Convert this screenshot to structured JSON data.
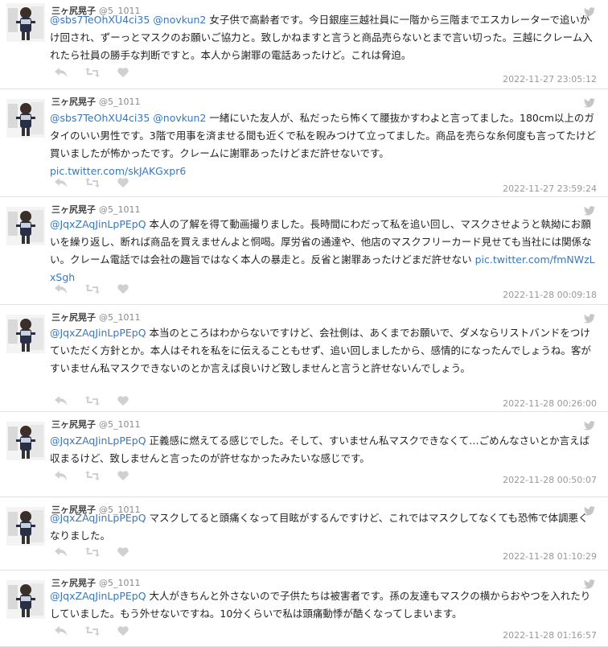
{
  "tweets": [
    {
      "name": "三ヶ尻晃子",
      "handle": "@5_1011",
      "mentions": "@sbs7TeOhXU4ci35 @novkun2",
      "text": " 女子供で高齢者です。今日銀座三越社員に一階から三階までエスカレーターで追いかけ回され、ずーっとマスクのお願いご協力と。致しかねますと言うと商品売らないとまで言い切った。三越にクレーム入れたら社員の勝手な判断ですと。本人から謝罪の電話あったけど。これは脅迫。",
      "link": "",
      "timestamp": "2022-11-27 23:05:12"
    },
    {
      "name": "三ヶ尻晃子",
      "handle": "@5_1011",
      "mentions": "@sbs7TeOhXU4ci35 @novkun2",
      "text": " 一緒にいた友人が、私だったら怖くて腰抜かすわよと言ってました。180cm以上のガタイのいい男性です。3階で用事を済ませる間も近くで私を睨みつけて立ってました。商品を売らな糸何度も言ってたけど買いましたが怖かったです。クレームに謝罪あったけどまだ許せないです。",
      "link": "pic.twitter.com/skJAKGxpr6",
      "timestamp": "2022-11-27 23:59:24"
    },
    {
      "name": "三ヶ尻晃子",
      "handle": "@5_1011",
      "mentions": "@JqxZAqJinLpPEpQ",
      "text": " 本人の了解を得て動画撮りました。長時間にわだって私を追い回し、マスクさせようと執拗にお願いを繰り返し、断れば商品を買えませんよと恫喝。厚労省の通達や、他店のマスクフリーカード見せても当社には関係ない。クレーム電話では会社の趣旨ではなく本人の暴走と。反省と謝罪あったけどまだ許せない ",
      "link": "pic.twitter.com/fmNWzLxSgh",
      "timestamp": "2022-11-28 00:09:18"
    },
    {
      "name": "三ヶ尻晃子",
      "handle": "@5_1011",
      "mentions": "@JqxZAqJinLpPEpQ",
      "text": " 本当のところはわからないですけど、会社側は、あくまでお願いで、ダメならリストバンドをつけていただく方針とか。本人はそれを私をに伝えることもせず、追い回しましたから、感情的になったんでしょうね。客がすいません私マスクできないのとか言えば良いけど致しませんと言うと許せないんでしょう。",
      "link": "",
      "timestamp": "2022-11-28 00:26:00"
    },
    {
      "name": "三ヶ尻晃子",
      "handle": "@5_1011",
      "mentions": "@JqxZAqJinLpPEpQ",
      "text": " 正義感に燃えてる感じでした。そして、すいません私マスクできなくて…ごめんなさいとか言えば収まるけど、致しませんと言ったのが許せなかったみたいな感じです。",
      "link": "",
      "timestamp": "2022-11-28 00:50:07"
    },
    {
      "name": "三ヶ尻晃子",
      "handle": "@5_1011",
      "mentions": "@JqxZAqJinLpPEpQ",
      "text": " マスクしてると頭痛くなって目眩がするんですけど、これではマスクしてなくても恐怖で体調悪くなりました。",
      "link": "",
      "timestamp": "2022-11-28 01:10:29"
    },
    {
      "name": "三ヶ尻晃子",
      "handle": "@5_1011",
      "mentions": "@JqxZAqJinLpPEpQ",
      "text": " 大人がきちんと外さないので子供たちは被害者です。孫の友達もマスクの横からおやつを入れたりしていました。もう外せないですね。10分くらいで私は頭痛動悸が酷くなってしまいます。",
      "link": "",
      "timestamp": "2022-11-28 01:16:57"
    }
  ]
}
